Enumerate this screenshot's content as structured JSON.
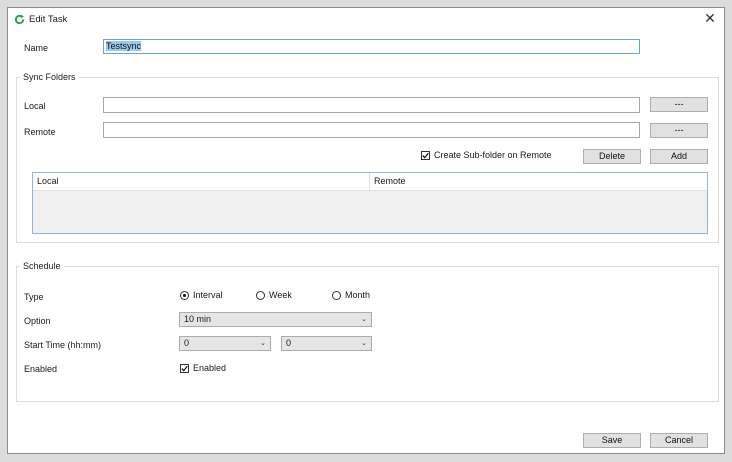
{
  "window": {
    "title": "Edit Task"
  },
  "name": {
    "label": "Name",
    "value": "Testsync"
  },
  "sync": {
    "group_label": "Sync Folders",
    "local_label": "Local",
    "remote_label": "Remote",
    "local_value": "",
    "remote_value": "",
    "browse_label": "---",
    "create_subfolder_label": "Create Sub-folder on Remote",
    "create_subfolder_checked": true,
    "delete_label": "Delete",
    "add_label": "Add",
    "table": {
      "columns": [
        "Local",
        "Remote"
      ],
      "rows": []
    }
  },
  "schedule": {
    "group_label": "Schedule",
    "type_label": "Type",
    "types": [
      "Interval",
      "Week",
      "Month"
    ],
    "selected_type": "Interval",
    "option_label": "Option",
    "option_value": "10 min",
    "start_label": "Start Time (hh:mm)",
    "start_hour": "0",
    "start_minute": "0",
    "enabled_label": "Enabled",
    "enabled_check_label": "Enabled",
    "enabled_checked": true
  },
  "footer": {
    "save_label": "Save",
    "cancel_label": "Cancel"
  },
  "colors": {
    "accent": "#0078d7",
    "selection": "#99c9ef",
    "refresh_icon": "#21a33a"
  }
}
